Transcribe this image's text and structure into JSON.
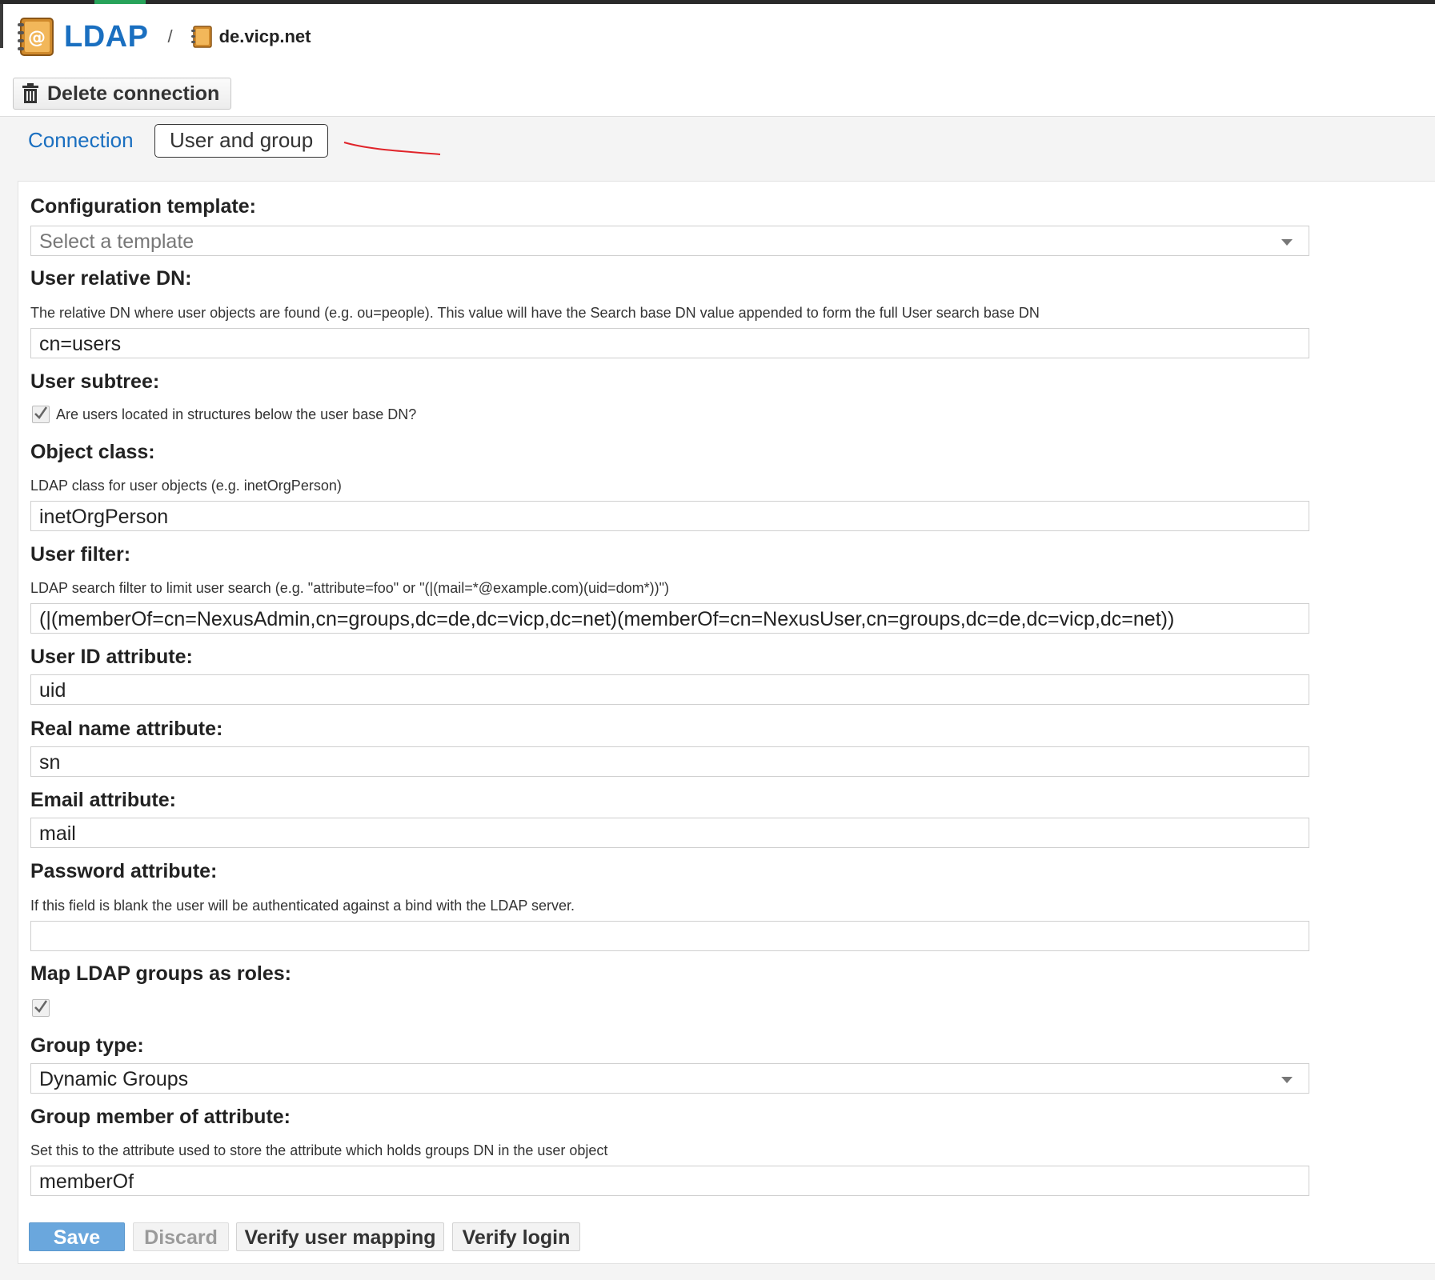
{
  "breadcrumb": {
    "title": "LDAP",
    "separator": "/",
    "connection_name": "de.vicp.net"
  },
  "toolbar": {
    "delete_label": "Delete connection"
  },
  "tabs": [
    {
      "label": "Connection",
      "active": false
    },
    {
      "label": "User and group",
      "active": true
    }
  ],
  "form": {
    "config_template": {
      "label": "Configuration template:",
      "placeholder": "Select a template"
    },
    "user_relative_dn": {
      "label": "User relative DN:",
      "help": "The relative DN where user objects are found (e.g. ou=people). This value will have the Search base DN value appended to form the full User search base DN",
      "value": "cn=users"
    },
    "user_subtree": {
      "label": "User subtree:",
      "checkbox_label": "Are users located in structures below the user base DN?",
      "checked": true
    },
    "object_class": {
      "label": "Object class:",
      "help": "LDAP class for user objects (e.g. inetOrgPerson)",
      "value": "inetOrgPerson"
    },
    "user_filter": {
      "label": "User filter:",
      "help": "LDAP search filter to limit user search (e.g. \"attribute=foo\" or \"(|(mail=*@example.com)(uid=dom*))\")",
      "value": "(|(memberOf=cn=NexusAdmin,cn=groups,dc=de,dc=vicp,dc=net)(memberOf=cn=NexusUser,cn=groups,dc=de,dc=vicp,dc=net))"
    },
    "user_id_attribute": {
      "label": "User ID attribute:",
      "value": "uid"
    },
    "real_name_attribute": {
      "label": "Real name attribute:",
      "value": "sn"
    },
    "email_attribute": {
      "label": "Email attribute:",
      "value": "mail"
    },
    "password_attribute": {
      "label": "Password attribute:",
      "help": "If this field is blank the user will be authenticated against a bind with the LDAP server.",
      "value": ""
    },
    "map_ldap_groups": {
      "label": "Map LDAP groups as roles:",
      "checked": true
    },
    "group_type": {
      "label": "Group type:",
      "value": "Dynamic Groups"
    },
    "group_member_of_attribute": {
      "label": "Group member of attribute:",
      "help": "Set this to the attribute used to store the attribute which holds groups DN in the user object",
      "value": "memberOf"
    }
  },
  "buttons": {
    "save": "Save",
    "discard": "Discard",
    "verify_user_mapping": "Verify user mapping",
    "verify_login": "Verify login"
  },
  "colors": {
    "link": "#1a6fc0",
    "save_button": "#6aa7dd",
    "annotation": "#e0242a"
  }
}
